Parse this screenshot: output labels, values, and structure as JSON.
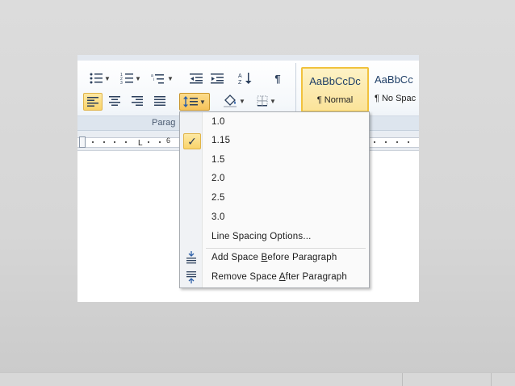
{
  "ribbon": {
    "group_label": "Parag",
    "styles": [
      {
        "sample": "AaBbCcDc",
        "name": "¶ Normal",
        "active": true
      },
      {
        "sample": "AaBbCc",
        "name": "¶ No Spac",
        "active": false
      }
    ]
  },
  "ruler": {
    "number": "6",
    "tab_marker": "L"
  },
  "line_spacing_menu": {
    "options": [
      "1.0",
      "1.15",
      "1.5",
      "2.0",
      "2.5",
      "3.0"
    ],
    "checked": "1.15",
    "options_link": "Line Spacing Options...",
    "add_space_before": {
      "pre": "Add Space ",
      "accel": "B",
      "post": "efore Paragraph"
    },
    "remove_space_after": {
      "pre": "Remove Space ",
      "accel": "A",
      "post": "fter Paragraph"
    }
  },
  "colors": {
    "accent_selected": "#f9d36a",
    "menu_background": "#fafafa",
    "ribbon_text": "#2b3f5c"
  }
}
